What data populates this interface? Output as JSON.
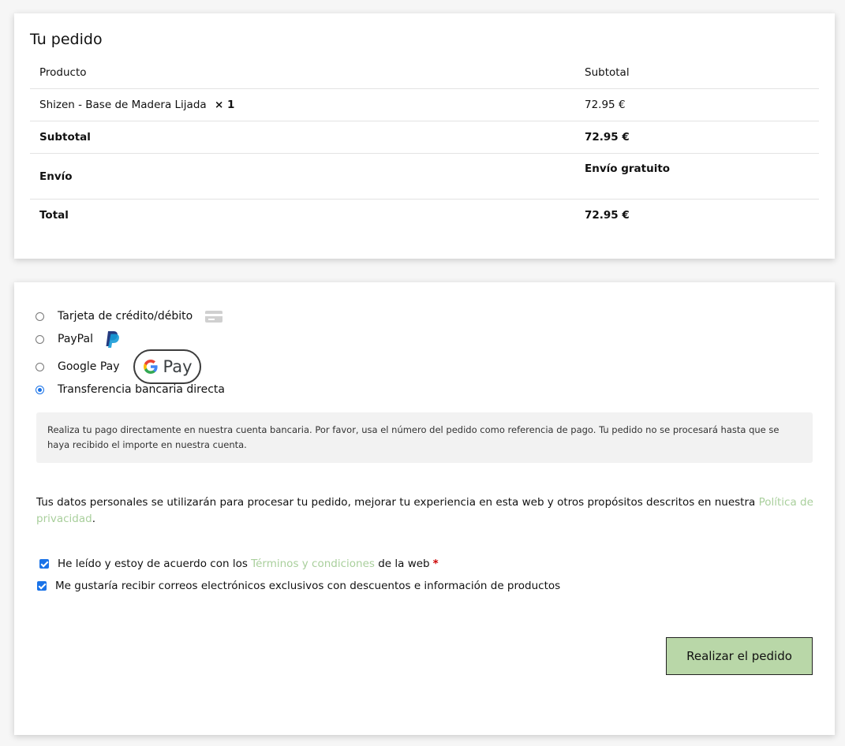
{
  "order": {
    "title": "Tu pedido",
    "headers": {
      "product": "Producto",
      "subtotal": "Subtotal"
    },
    "item": {
      "name": "Shizen - Base de Madera Lijada",
      "quantity": "× 1",
      "price": "72.95 €"
    },
    "subtotal": {
      "label": "Subtotal",
      "value": "72.95 €"
    },
    "shipping": {
      "label": "Envío",
      "value": "Envío gratuito"
    },
    "total": {
      "label": "Total",
      "value": "72.95 €"
    }
  },
  "payment": {
    "methods": [
      {
        "label": "Tarjeta de crédito/débito",
        "icon": "credit-card-icon",
        "selected": false
      },
      {
        "label": "PayPal",
        "icon": "paypal-icon",
        "selected": false
      },
      {
        "label": "Google Pay",
        "icon": "google-pay-icon",
        "selected": false
      },
      {
        "label": "Transferencia bancaria directa",
        "selected": true
      }
    ],
    "gpay_button_label": "Pay",
    "bank_transfer_description": "Realiza tu pago directamente en nuestra cuenta bancaria. Por favor, usa el número del pedido como referencia de pago. Tu pedido no se procesará hasta que se haya recibido el importe en nuestra cuenta."
  },
  "privacy": {
    "text": "Tus datos personales se utilizarán para procesar tu pedido, mejorar tu experiencia en esta web y otros propósitos descritos en nuestra ",
    "link": "Política de privacidad",
    "suffix": "."
  },
  "terms": {
    "prefix": "He leído y estoy de acuerdo con los ",
    "link": "Términos y condiciones",
    "suffix": " de la web",
    "required": "*",
    "checked": true
  },
  "newsletter": {
    "label": "Me gustaría recibir correos electrónicos exclusivos con descuentos e información de productos",
    "checked": true
  },
  "place_order_label": "Realizar el pedido",
  "colors": {
    "accent": "#1a73e8",
    "link": "#a9cf9c",
    "button_bg": "#b9d7a8",
    "required": "#cc0000"
  }
}
